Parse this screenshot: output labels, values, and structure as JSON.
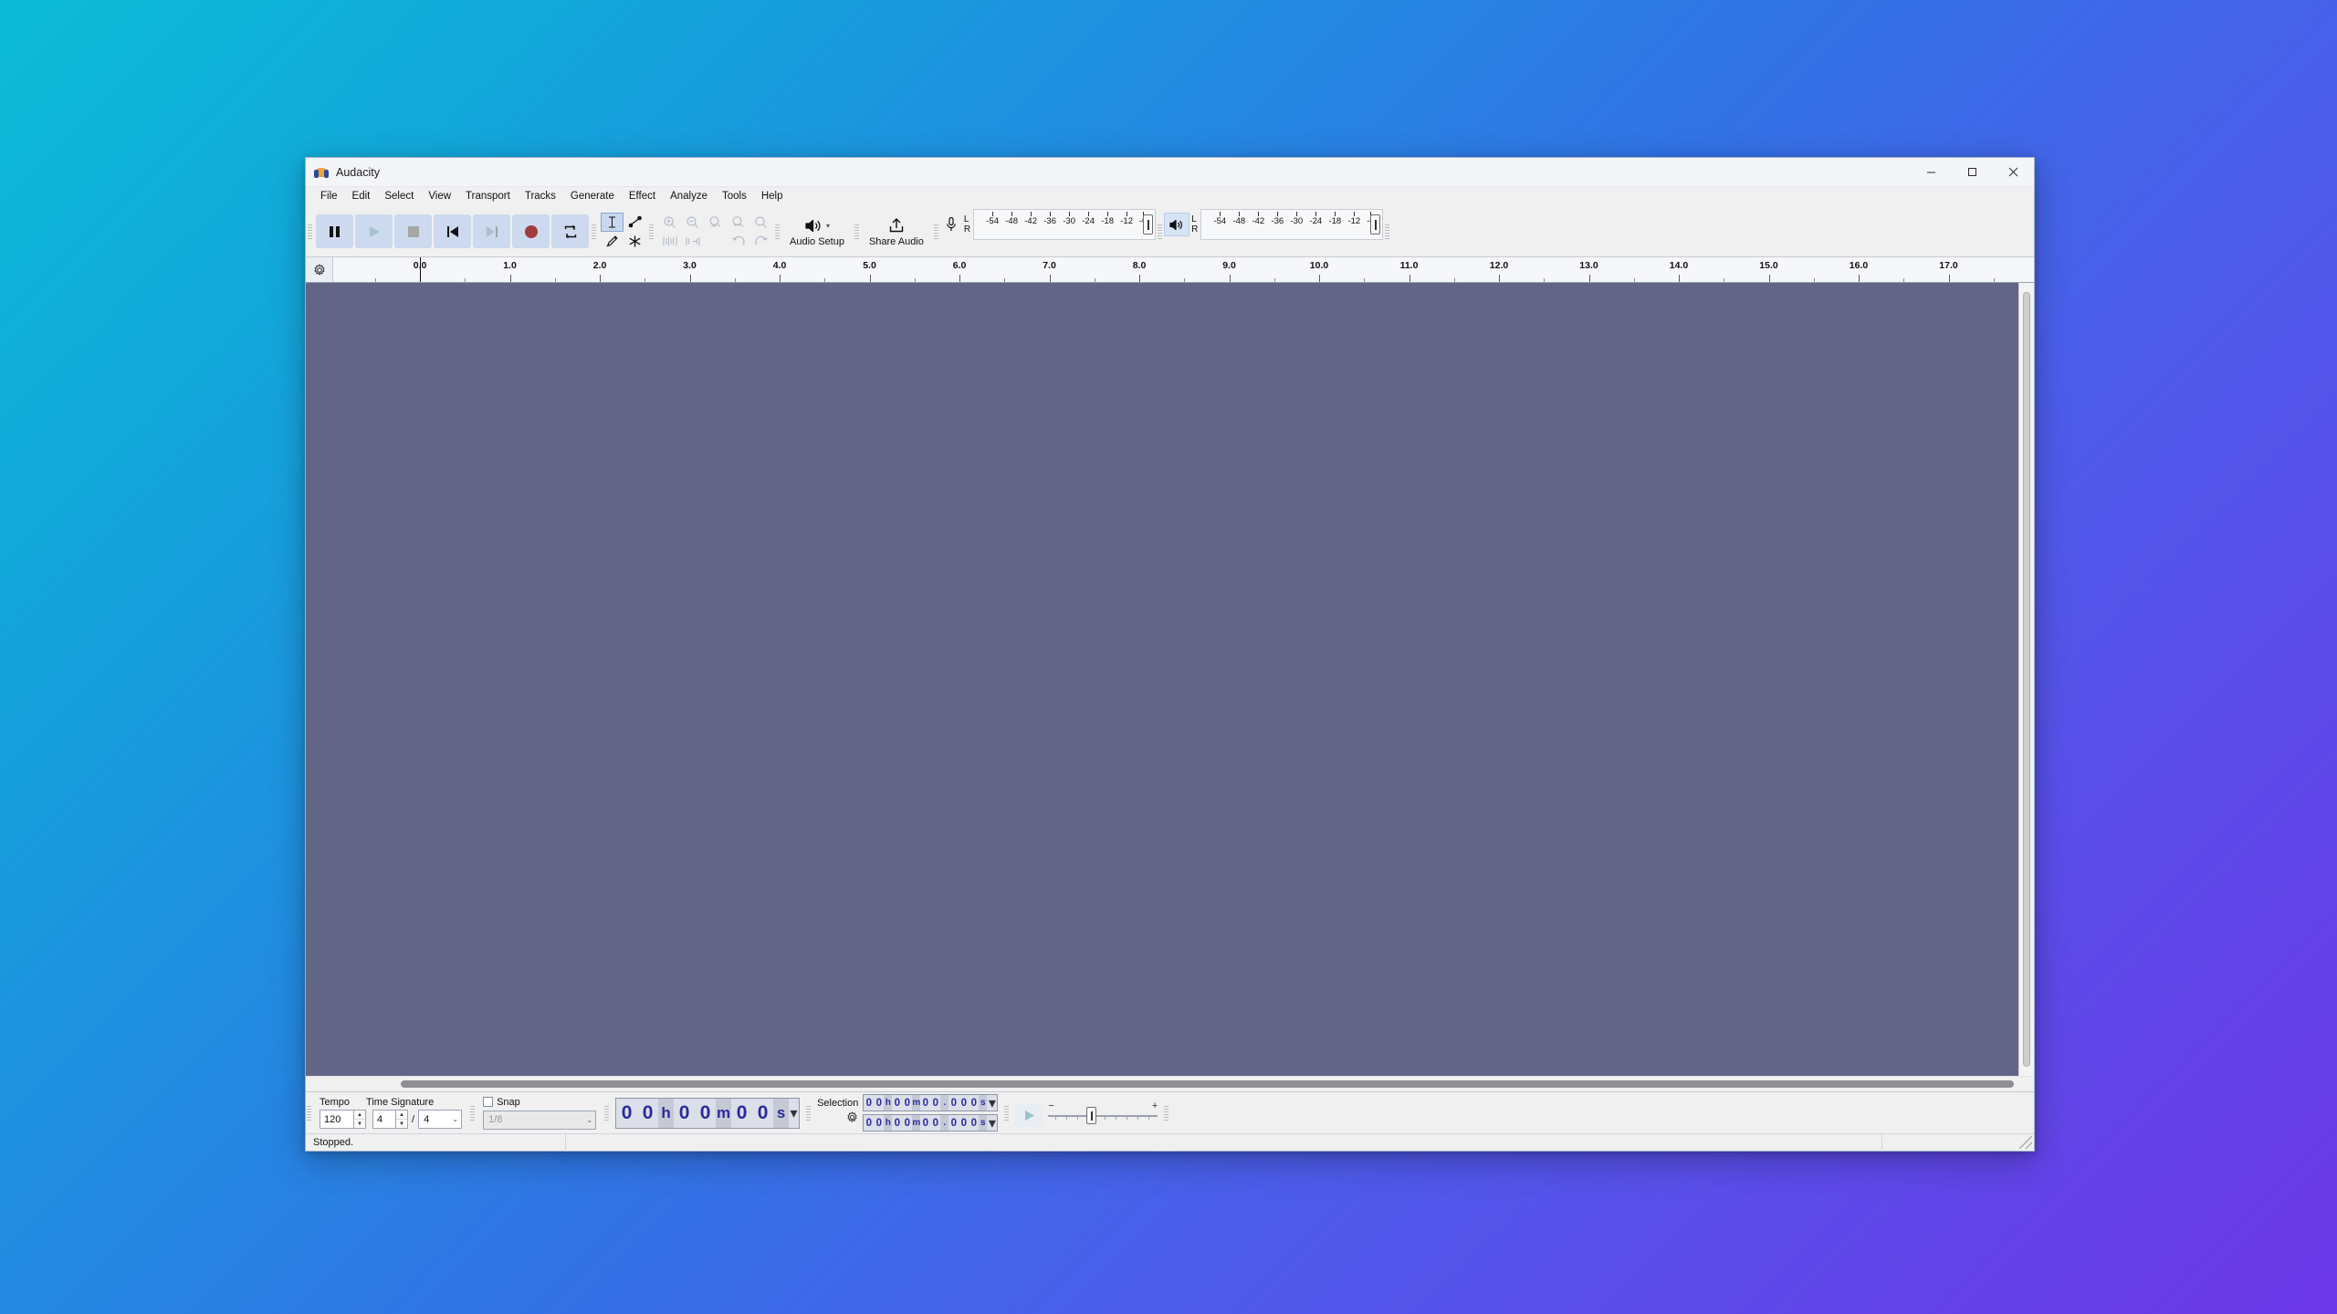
{
  "window": {
    "title": "Audacity",
    "logo_icon": "audacity-logo-icon",
    "minimize_label": "minimize-icon",
    "maximize_label": "maximize-icon",
    "close_label": "close-icon"
  },
  "menubar": {
    "items": [
      {
        "label": "File"
      },
      {
        "label": "Edit"
      },
      {
        "label": "Select"
      },
      {
        "label": "View"
      },
      {
        "label": "Transport"
      },
      {
        "label": "Tracks"
      },
      {
        "label": "Generate"
      },
      {
        "label": "Effect"
      },
      {
        "label": "Analyze"
      },
      {
        "label": "Tools"
      },
      {
        "label": "Help"
      }
    ]
  },
  "transport": {
    "buttons": [
      {
        "name": "pause-button",
        "icon": "pause-icon",
        "enabled": true
      },
      {
        "name": "play-button",
        "icon": "play-icon",
        "enabled": false
      },
      {
        "name": "stop-button",
        "icon": "stop-icon",
        "enabled": false
      },
      {
        "name": "skip-to-start-button",
        "icon": "skip-start-icon",
        "enabled": true
      },
      {
        "name": "skip-to-end-button",
        "icon": "skip-end-icon",
        "enabled": false
      },
      {
        "name": "record-button",
        "icon": "record-icon",
        "enabled": true
      },
      {
        "name": "loop-button",
        "icon": "loop-icon",
        "enabled": true
      }
    ]
  },
  "tools": {
    "items": [
      {
        "name": "selection-tool",
        "icon": "i-beam-icon",
        "active": true
      },
      {
        "name": "envelope-tool",
        "icon": "envelope-icon",
        "active": false
      },
      {
        "name": "draw-tool",
        "icon": "pencil-icon",
        "active": false
      },
      {
        "name": "multi-tool",
        "icon": "star-icon",
        "active": false
      }
    ]
  },
  "edit_toolbar": {
    "items": [
      {
        "name": "zoom-in-button",
        "icon": "zoom-in-icon"
      },
      {
        "name": "zoom-out-button",
        "icon": "zoom-out-icon"
      },
      {
        "name": "fit-selection-button",
        "icon": "fit-selection-icon"
      },
      {
        "name": "fit-project-button",
        "icon": "fit-project-icon"
      },
      {
        "name": "zoom-toggle-button",
        "icon": "zoom-toggle-icon"
      },
      {
        "name": "trim-audio-button",
        "icon": "trim-audio-icon"
      },
      {
        "name": "silence-audio-button",
        "icon": "silence-audio-icon"
      },
      {
        "name": "undo-button",
        "icon": "undo-icon"
      },
      {
        "name": "redo-button",
        "icon": "redo-icon"
      }
    ]
  },
  "audio_setup": {
    "label": "Audio Setup",
    "icon": "speaker-icon",
    "chevron": "▾"
  },
  "share_audio": {
    "label": "Share Audio",
    "icon": "upload-icon"
  },
  "recording_meter": {
    "icon": "microphone-icon",
    "channel_top": "L",
    "channel_bottom": "R",
    "scale": [
      "-54",
      "-48",
      "-42",
      "-36",
      "-30",
      "-24",
      "-18",
      "-12",
      "-6"
    ]
  },
  "playback_meter": {
    "icon": "speaker-icon",
    "channel_top": "L",
    "channel_bottom": "R",
    "scale": [
      "-54",
      "-48",
      "-42",
      "-36",
      "-30",
      "-24",
      "-18",
      "-12",
      "-6"
    ]
  },
  "timeline": {
    "gear_icon": "timeline-options-gear-icon",
    "labels": [
      "0.0",
      "1.0",
      "2.0",
      "3.0",
      "4.0",
      "5.0",
      "6.0",
      "7.0",
      "8.0",
      "9.0",
      "10.0",
      "11.0",
      "12.0",
      "13.0",
      "14.0",
      "15.0",
      "16.0",
      "17.0"
    ],
    "playhead_label": "0.0"
  },
  "track_panel": {
    "background_color": "#636586",
    "empty": true
  },
  "bottom": {
    "tempo_label": "Tempo",
    "tempo_value": "120",
    "time_signature_label": "Time Signature",
    "time_sig_upper": "4",
    "time_sig_divider": "/",
    "time_sig_lower": "4",
    "snap_label": "Snap",
    "snap_checked": false,
    "snap_value": "1/8",
    "audio_position": {
      "digits": [
        "0",
        "0",
        "0",
        "0",
        "0",
        "0"
      ],
      "units": [
        "h",
        "m",
        "s"
      ],
      "text": "00 h 00 m 00 s"
    },
    "selection_label": "Selection",
    "selection_gear_icon": "selection-options-gear-icon",
    "selection_start": "00h00m00.000s",
    "selection_end": "00h00m00.000s",
    "play_at_speed_icon": "play-at-speed-icon",
    "speed_minus": "−",
    "speed_plus": "+"
  },
  "statusbar": {
    "message": "Stopped.",
    "cell2": "",
    "cell3": "",
    "resize_grip": "resize-grip-icon"
  },
  "colors": {
    "track_background": "#636586",
    "transport_button": "#ccd9ee",
    "accent_blue": "#2a2a9c",
    "record_red": "#a33c3c",
    "desktop_cyan": "#0cbcd6",
    "desktop_purple": "#6d38e8"
  }
}
